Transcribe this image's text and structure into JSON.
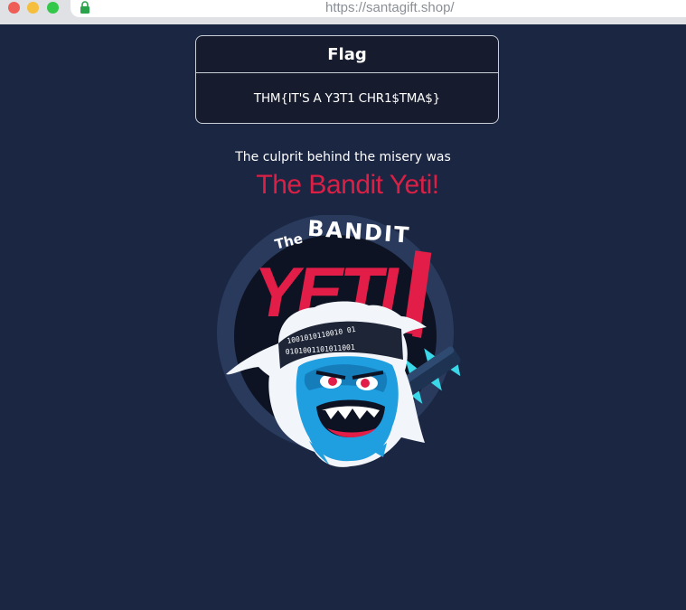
{
  "browser": {
    "url": "https://santagift.shop/"
  },
  "flag_card": {
    "title": "Flag",
    "value": "THM{IT'S A Y3T1 CHR1$TMA$}"
  },
  "message": {
    "intro": "The culprit behind the misery was",
    "culprit": "The Bandit Yeti!"
  },
  "logo": {
    "icon": "bandit-yeti-logo",
    "top_text": "The BANDIT",
    "main_text": "YETI",
    "bandana_binary": "01001010 0110110 0101001",
    "colors": {
      "red": "#e21d48",
      "blue": "#1f9ee0",
      "dark": "#0d1322"
    }
  }
}
